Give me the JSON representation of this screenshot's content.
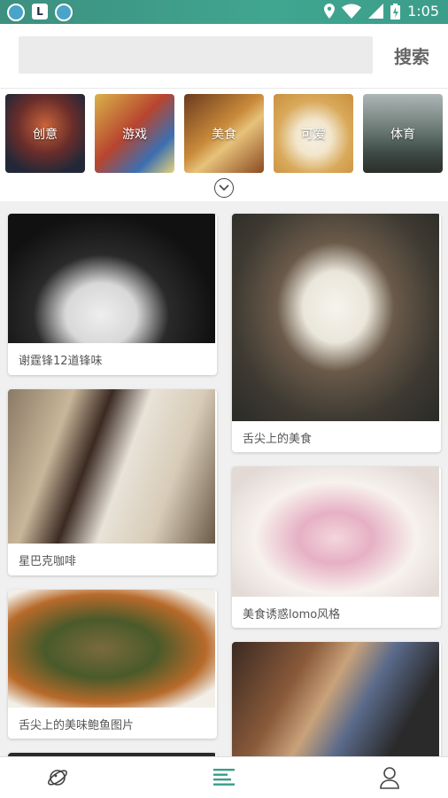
{
  "status": {
    "time": "1:05",
    "app_badge": "L"
  },
  "search": {
    "placeholder": "",
    "button_label": "搜索"
  },
  "categories": [
    {
      "label": "创意"
    },
    {
      "label": "游戏"
    },
    {
      "label": "美食"
    },
    {
      "label": "可爱"
    },
    {
      "label": "体育"
    }
  ],
  "feed": {
    "left": [
      {
        "caption": "谢霆锋12道锋味"
      },
      {
        "caption": "星巴克咖啡"
      },
      {
        "caption": "舌尖上的美味鲍鱼图片"
      }
    ],
    "right": [
      {
        "caption": "舌尖上的美食"
      },
      {
        "caption": "美食诱惑lomo风格"
      },
      {
        "caption": ""
      }
    ]
  },
  "tabs": [
    {
      "icon": "planet-icon"
    },
    {
      "icon": "list-icon"
    },
    {
      "icon": "user-icon"
    }
  ],
  "colors": {
    "status_bar": "#40a690",
    "accent": "#3b9d8a"
  }
}
